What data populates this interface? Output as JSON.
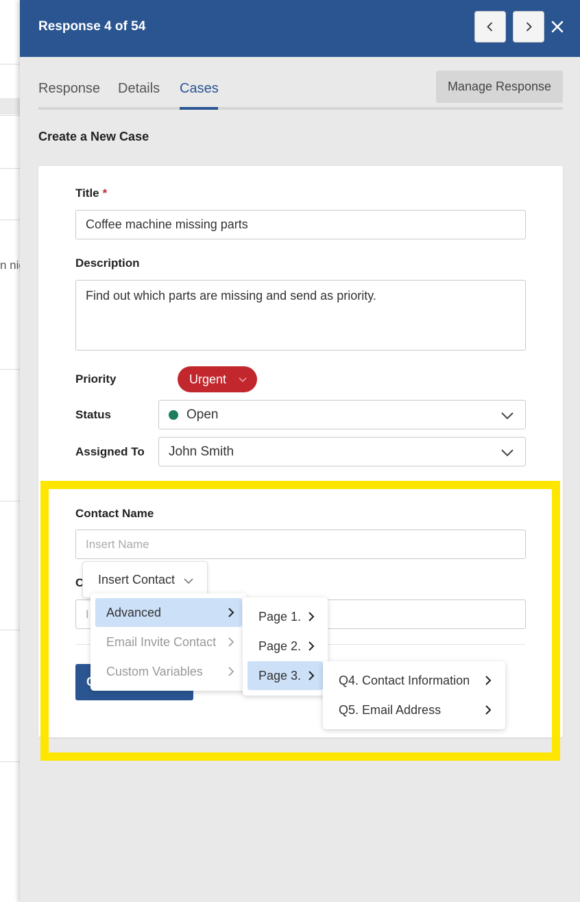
{
  "background": {
    "partial_text": "n nig"
  },
  "header": {
    "title": "Response 4 of 54"
  },
  "tabs": {
    "response": "Response",
    "details": "Details",
    "cases": "Cases"
  },
  "manage_button": "Manage Response",
  "section_title": "Create a New Case",
  "form": {
    "title_label": "Title",
    "required_marker": "*",
    "title_value": "Coffee machine missing parts",
    "description_label": "Description",
    "description_value": "Find out which parts are missing and send as priority.",
    "priority_label": "Priority",
    "priority_value": "Urgent",
    "status_label": "Status",
    "status_value": "Open",
    "assigned_label": "Assigned To",
    "assigned_value": "John Smith",
    "contact_name_label": "Contact Name",
    "contact_name_placeholder": "Insert Name",
    "second_label_visible": "C",
    "second_input_visible": "I",
    "create_button_visible": "C"
  },
  "insert_contact": {
    "label": "Insert Contact"
  },
  "menu_level1": [
    {
      "label": "Advanced",
      "state": "active"
    },
    {
      "label": "Email Invite Contact",
      "state": "disabled"
    },
    {
      "label": "Custom Variables",
      "state": "disabled"
    }
  ],
  "menu_level2": [
    {
      "label": "Page 1."
    },
    {
      "label": "Page 2."
    },
    {
      "label": "Page 3.",
      "state": "active"
    }
  ],
  "menu_level3": [
    {
      "label": "Q4. Contact Information"
    },
    {
      "label": "Q5. Email Address"
    }
  ],
  "colors": {
    "header_bg": "#2a5591",
    "urgent": "#c1272d",
    "status_open": "#1e7e5b",
    "highlight": "#ffe600",
    "menu_active": "#cce0f8"
  }
}
